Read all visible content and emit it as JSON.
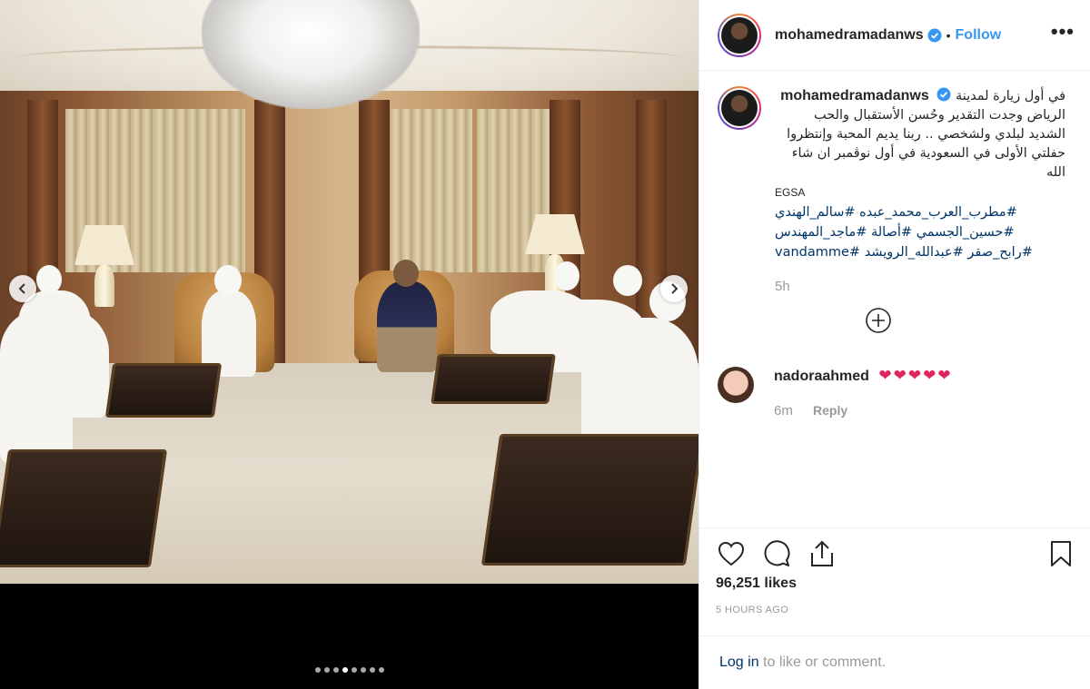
{
  "post": {
    "username": "mohamedramadanws",
    "follow_label": "Follow",
    "bullet": "•",
    "more_label": "•••",
    "caption_arabic": "في أول زيارة لمدينة الرياض وجدت التقدير وحُسن الأستقبال والحب الشديد لبلدي ولشخصي .. ربنا يديم المحبة وإنتظروا حفلتي الأولى في السعودية في أول نوڤمبر ان شاء الله",
    "caption_latin": "EGSA",
    "hashtags": [
      "#مطرب_العرب_محمد_عبده",
      "#سالم_الهندي",
      "#حسين_الجسمي",
      "#أصالة",
      "#ماجد_المهندس",
      "#رابح_صقر",
      "#عبدالله_الرويشد",
      "#vandamme"
    ],
    "caption_time": "5h",
    "likes": "96,251 likes",
    "posted_ago": "5 HOURS AGO"
  },
  "comment": {
    "username": "nadoraahmed",
    "text": "❤❤❤❤❤",
    "time": "6m",
    "reply_label": "Reply"
  },
  "login": {
    "link": "Log in",
    "rest": " to like or comment."
  },
  "carousel": {
    "dot_count": 8,
    "active_index": 3
  },
  "colors": {
    "link_blue": "#3897f0",
    "hashtag_blue": "#003569",
    "muted": "#999999",
    "heart_red": "#e0245e"
  },
  "icons": [
    "chevron-left-icon",
    "chevron-right-icon",
    "verified-badge-icon",
    "more-icon",
    "load-more-icon",
    "heart-icon",
    "comment-icon",
    "share-icon",
    "bookmark-icon"
  ]
}
